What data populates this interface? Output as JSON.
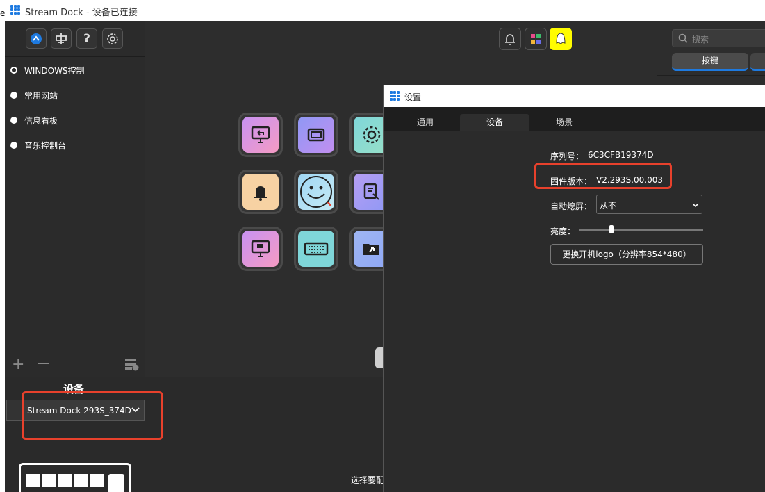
{
  "app": {
    "title": "Stream Dock - 设备已连接",
    "edge_text": "e"
  },
  "sidebar": {
    "toolbar": [
      {
        "icon": "stream-dock-icon"
      },
      {
        "icon": "store-icon"
      },
      {
        "label": "?",
        "icon": "help-icon"
      },
      {
        "icon": "gear-icon"
      }
    ],
    "categories": [
      {
        "label": "WINDOWS控制",
        "active": true
      },
      {
        "label": "常用网站",
        "active": false
      },
      {
        "label": "信息看板",
        "active": false
      },
      {
        "label": "音乐控制台",
        "active": false
      }
    ]
  },
  "device": {
    "title": "设备",
    "selected": "Stream Dock 293S_374D"
  },
  "main": {
    "hint": "选择要配"
  },
  "right_panel": {
    "search_placeholder": "搜索",
    "tab_key": "按键"
  },
  "settings": {
    "title": "设置",
    "tabs": [
      "通用",
      "设备",
      "场景"
    ],
    "active_tab": "设备",
    "serial_label": "序列号：",
    "serial_value": "6C3CFB19374D",
    "firmware_label": "固件版本：",
    "firmware_value": "V2.293S.00.003",
    "sleep_label": "自动熄屏：",
    "sleep_value": "从不",
    "brightness_label": "亮度：",
    "brightness_level": 0.26,
    "logo_button": "更换开机logo（分辨率854*480）"
  },
  "colors": {
    "accent": "#1e7ae0",
    "annotation_red": "#e8412c",
    "background": "#2d2d2d"
  }
}
